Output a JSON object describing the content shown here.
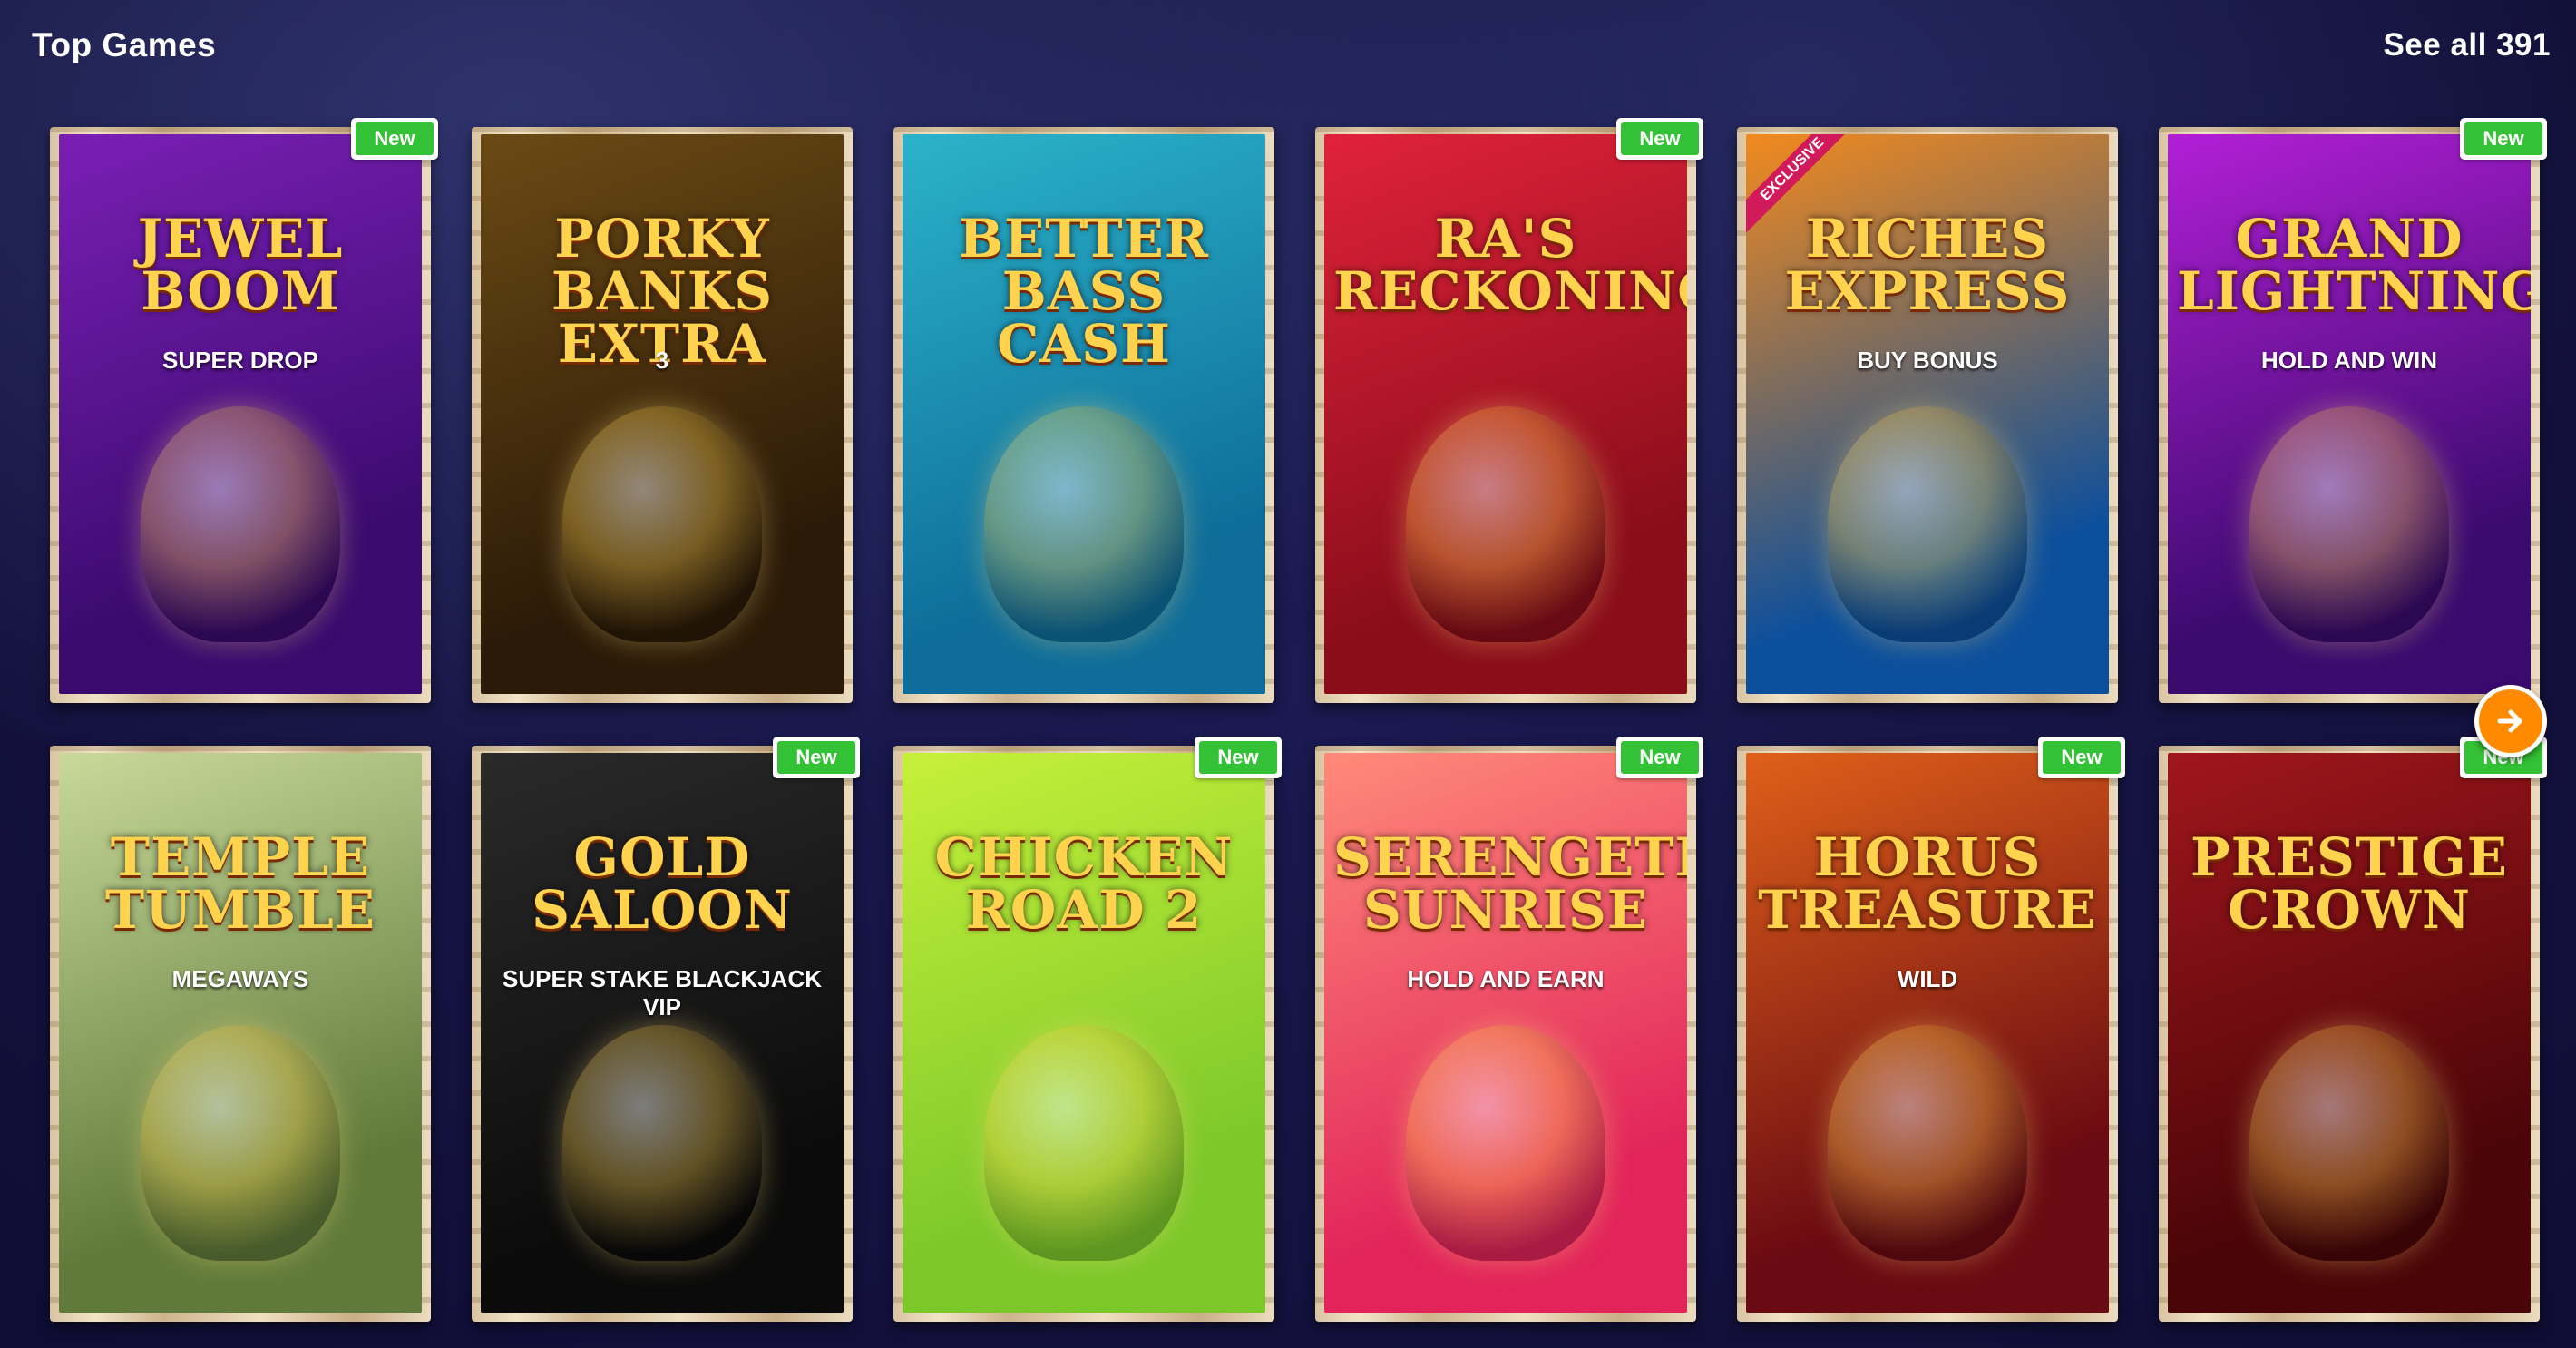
{
  "header": {
    "title": "Top Games",
    "see_all": "See all 391"
  },
  "badge_label": "New",
  "games": [
    {
      "title": "JEWEL BOOM",
      "subtitle": "SUPER DROP",
      "is_new": true,
      "colors": [
        "#3a0a6e",
        "#7a1fb5"
      ],
      "icon": "diamond-icon"
    },
    {
      "title": "PORKY BANKS EXTRA",
      "subtitle": "3",
      "is_new": false,
      "colors": [
        "#2b1a08",
        "#6b4a14"
      ],
      "icon": "piggy-bank-icon"
    },
    {
      "title": "BETTER BASS CASH",
      "subtitle": "",
      "is_new": false,
      "colors": [
        "#0e6d9a",
        "#2bb3c9"
      ],
      "icon": "fisherman-icon"
    },
    {
      "title": "RA'S RECKONING",
      "subtitle": "",
      "is_new": true,
      "colors": [
        "#8a0d1a",
        "#e0223a"
      ],
      "icon": "ra-warrior-icon"
    },
    {
      "title": "RICHES EXPRESS",
      "subtitle": "BUY BONUS",
      "exclusive": "EXCLUSIVE",
      "is_new": false,
      "colors": [
        "#0c4f9c",
        "#f28a1e"
      ],
      "icon": "train-icon"
    },
    {
      "title": "GRAND LIGHTNING",
      "subtitle": "HOLD AND WIN",
      "is_new": true,
      "colors": [
        "#3a0a6e",
        "#b21fd6"
      ],
      "icon": "lightning-icon"
    },
    {
      "title": "TEMPLE TUMBLE",
      "subtitle": "MEGAWAYS",
      "is_new": false,
      "colors": [
        "#5f7a3a",
        "#c8d99a"
      ],
      "icon": "explorer-icon"
    },
    {
      "title": "GOLD SALOON",
      "subtitle": "SUPER STAKE BLACKJACK VIP",
      "is_new": true,
      "colors": [
        "#0b0b0b",
        "#2a2a2a"
      ],
      "icon": "dealer-icon"
    },
    {
      "title": "CHICKEN ROAD 2",
      "subtitle": "",
      "is_new": true,
      "colors": [
        "#7cc82a",
        "#c6f03a"
      ],
      "icon": "chicken-icon"
    },
    {
      "title": "SERENGETI SUNRISE",
      "subtitle": "HOLD AND EARN",
      "is_new": true,
      "colors": [
        "#e2245a",
        "#ff8a7a"
      ],
      "icon": "lion-icon"
    },
    {
      "title": "HORUS TREASURE",
      "subtitle": "WILD",
      "is_new": true,
      "colors": [
        "#6a0a12",
        "#e0601a"
      ],
      "icon": "pharaoh-icon"
    },
    {
      "title": "PRESTIGE CROWN",
      "subtitle": "",
      "is_new": true,
      "colors": [
        "#4a0508",
        "#a0161c"
      ],
      "icon": "crown-icon"
    }
  ],
  "next_button_icon": "arrow-right-icon"
}
